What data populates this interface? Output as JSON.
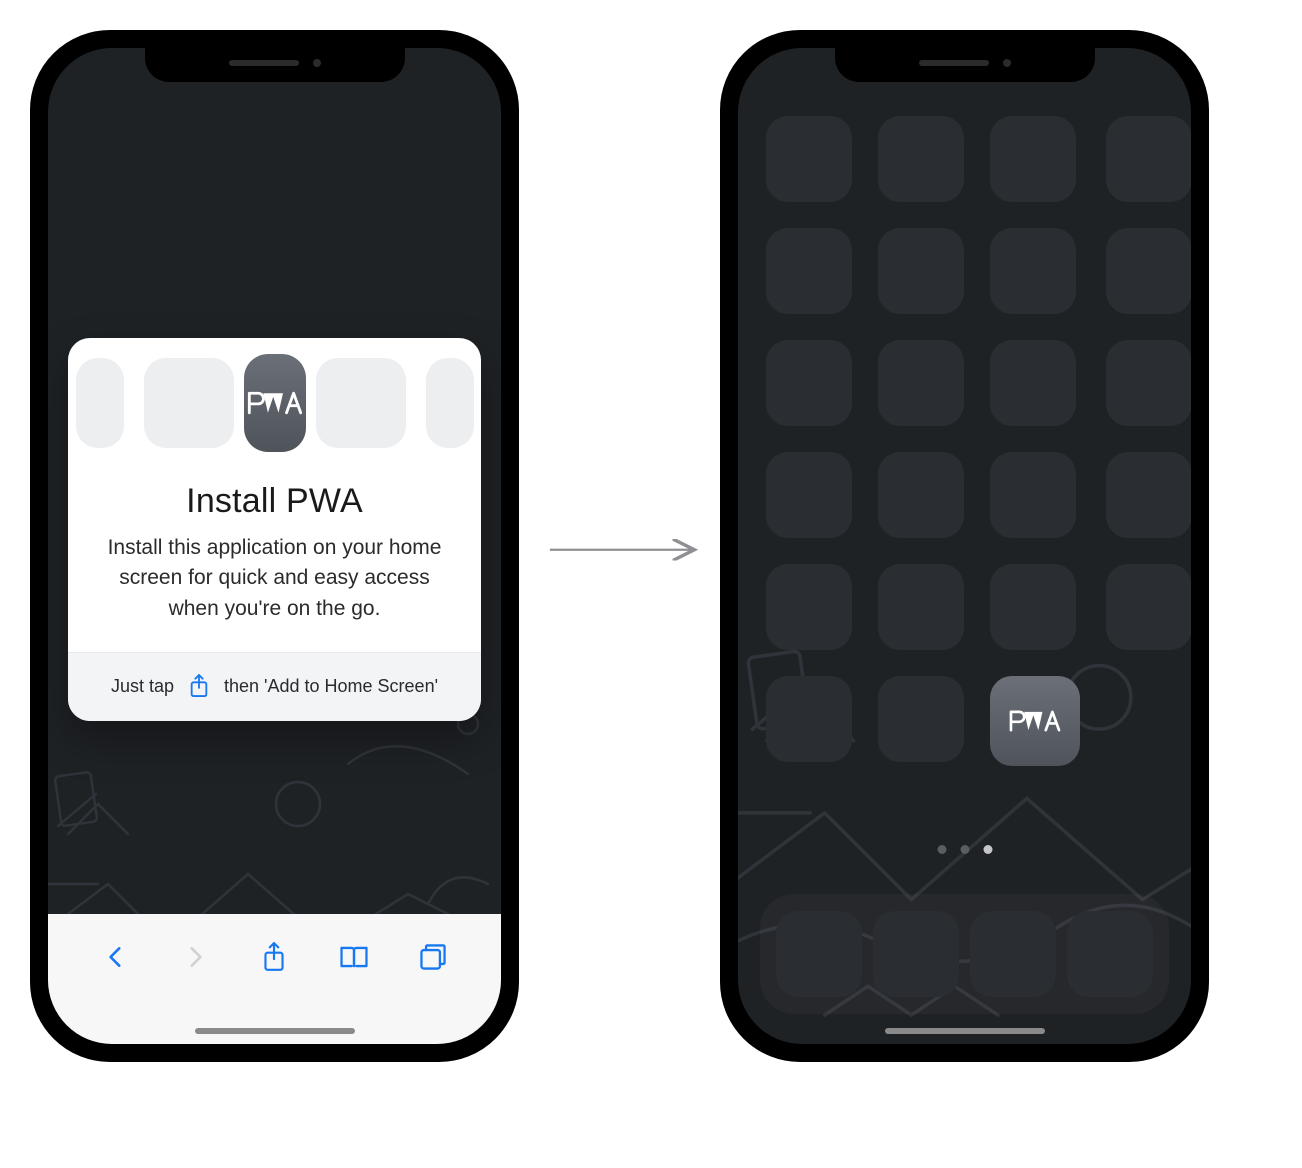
{
  "modal": {
    "title": "Install PWA",
    "description": "Install this application on your home screen for quick and easy access when you're on the go.",
    "hint_before": "Just tap",
    "hint_after": "then 'Add to Home Screen'",
    "app_label": "PWA"
  },
  "home": {
    "installed_app_label": "PWA"
  }
}
